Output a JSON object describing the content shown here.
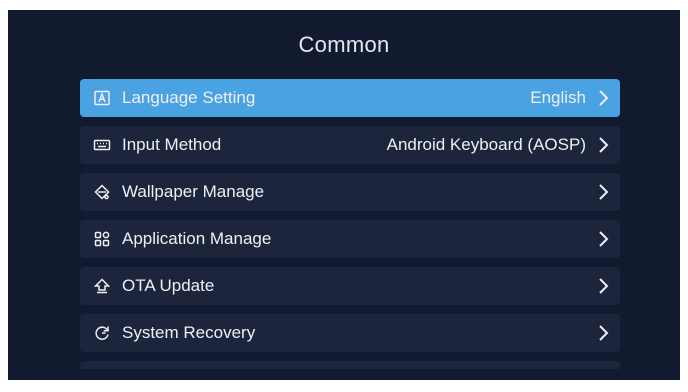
{
  "page": {
    "title": "Common"
  },
  "menu": {
    "items": [
      {
        "label": "Language Setting",
        "value": "English",
        "icon": "language-icon",
        "selected": true
      },
      {
        "label": "Input Method",
        "value": "Android Keyboard (AOSP)",
        "icon": "keyboard-icon",
        "selected": false
      },
      {
        "label": "Wallpaper Manage",
        "value": "",
        "icon": "wallpaper-icon",
        "selected": false
      },
      {
        "label": "Application Manage",
        "value": "",
        "icon": "apps-grid-icon",
        "selected": false
      },
      {
        "label": "OTA Update",
        "value": "",
        "icon": "ota-update-icon",
        "selected": false
      },
      {
        "label": "System Recovery",
        "value": "",
        "icon": "recovery-icon",
        "selected": false
      }
    ]
  },
  "colors": {
    "background": "#121a30",
    "row": "#1d253d",
    "selected": "#4aa2e3",
    "text": "#eef0f5"
  }
}
